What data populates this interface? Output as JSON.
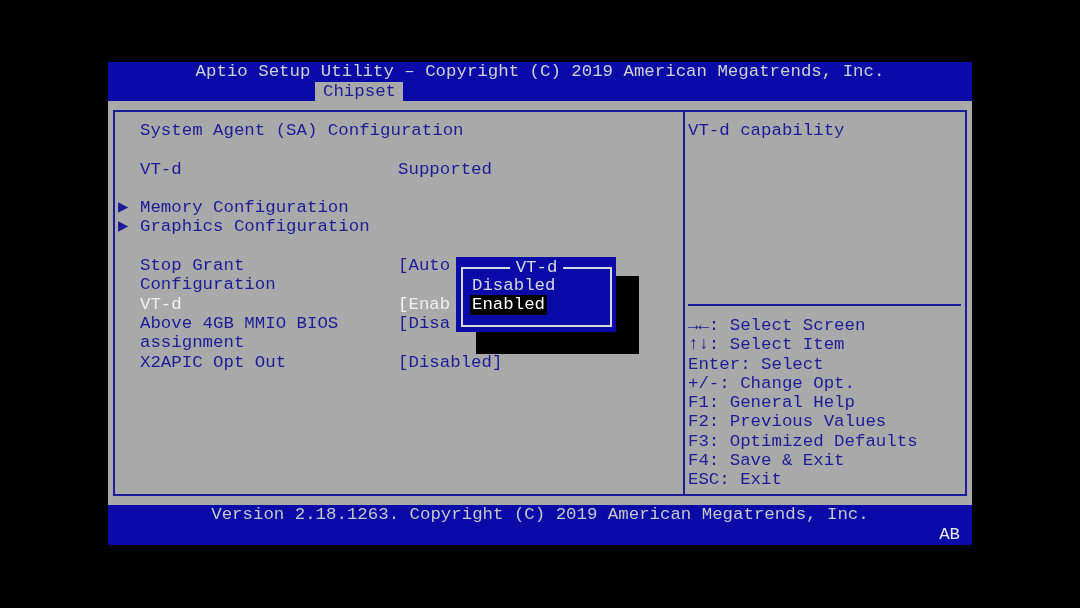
{
  "header": {
    "title": "Aptio Setup Utility – Copyright (C) 2019 American Megatrends, Inc.",
    "tabs": [
      {
        "label": "Chipset",
        "selected": true
      }
    ]
  },
  "left_panel": {
    "heading": "System Agent (SA) Configuration",
    "info": [
      {
        "label": "VT-d",
        "value": "Supported"
      }
    ],
    "submenus": [
      {
        "marker": "▶",
        "label": "Memory Configuration"
      },
      {
        "marker": "▶",
        "label": "Graphics Configuration"
      }
    ],
    "settings": [
      {
        "label": "Stop Grant Configuration",
        "value": "[Auto",
        "selected": false
      },
      {
        "label": "VT-d",
        "value": "[Enab",
        "selected": true
      },
      {
        "label": "Above 4GB MMIO BIOS assignment",
        "value": "[Disa",
        "selected": false
      },
      {
        "label": "X2APIC Opt Out",
        "value": "[Disabled]",
        "selected": false
      }
    ]
  },
  "popup": {
    "title": "VT-d",
    "options": [
      {
        "label": "Disabled",
        "selected": false
      },
      {
        "label": "Enabled",
        "selected": true
      }
    ]
  },
  "help_panel": {
    "description": "VT-d capability",
    "keys": [
      "→←: Select Screen",
      "↑↓: Select Item",
      "Enter: Select",
      "+/-: Change Opt.",
      "F1: General Help",
      "F2: Previous Values",
      "F3: Optimized Defaults",
      "F4: Save & Exit",
      "ESC: Exit"
    ]
  },
  "footer": {
    "version": "Version 2.18.1263. Copyright (C) 2019 American Megatrends, Inc.",
    "badge": "AB"
  }
}
